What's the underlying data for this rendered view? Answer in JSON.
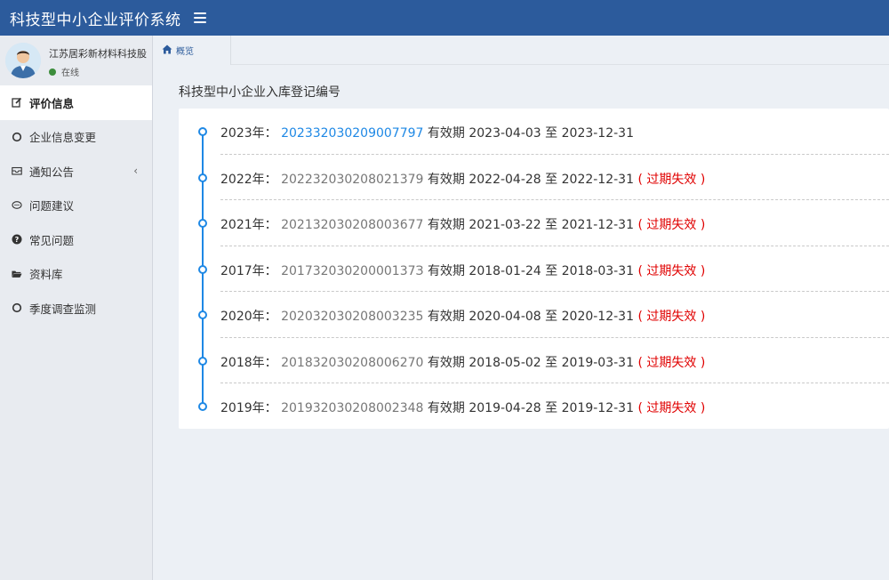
{
  "app": {
    "title": "科技型中小企业评价系统"
  },
  "user": {
    "name": "江苏居彩新材料科技股",
    "status": "在线"
  },
  "sidebar": {
    "items": [
      {
        "label": "评价信息",
        "icon": "edit-icon",
        "active": true
      },
      {
        "label": "企业信息变更",
        "icon": "circle-icon"
      },
      {
        "label": "通知公告",
        "icon": "envelope-icon",
        "has_arrow": true,
        "arrow": "‹"
      },
      {
        "label": "问题建议",
        "icon": "comment-icon"
      },
      {
        "label": "常见问题",
        "icon": "question-icon"
      },
      {
        "label": "资料库",
        "icon": "folder-icon"
      },
      {
        "label": "季度调查监测",
        "icon": "circle-icon"
      }
    ]
  },
  "breadcrumb": {
    "label": "概览",
    "icon": "home-icon"
  },
  "main": {
    "title": "科技型中小企业入库登记编号",
    "validity_prefix": "有效期",
    "to_word": "至",
    "expired_label": "( 过期失效 )",
    "entries": [
      {
        "year": "2023年：",
        "code": "202332030209007797",
        "start": "2023-04-03",
        "end": "2023-12-31",
        "expired": false
      },
      {
        "year": "2022年：",
        "code": "202232030208021379",
        "start": "2022-04-28",
        "end": "2022-12-31",
        "expired": true
      },
      {
        "year": "2021年：",
        "code": "202132030208003677",
        "start": "2021-03-22",
        "end": "2021-12-31",
        "expired": true
      },
      {
        "year": "2017年：",
        "code": "20173203020000137З",
        "start": "2018-01-24",
        "end": "2018-03-31",
        "expired": true
      },
      {
        "year": "2020年：",
        "code": "202032030208003235",
        "start": "2020-04-08",
        "end": "2020-12-31",
        "expired": true
      },
      {
        "year": "2018年：",
        "code": "201832030208006270",
        "start": "2018-05-02",
        "end": "2019-03-31",
        "expired": true
      },
      {
        "year": "2019年：",
        "code": "201932030208002348",
        "start": "2019-04-28",
        "end": "2019-12-31",
        "expired": true
      }
    ]
  },
  "colors": {
    "header": "#2c5b9c",
    "link": "#1e88e5",
    "expired": "#e00000",
    "sidebar_bg": "#e8ebf0",
    "page_bg": "#ecf0f5"
  }
}
